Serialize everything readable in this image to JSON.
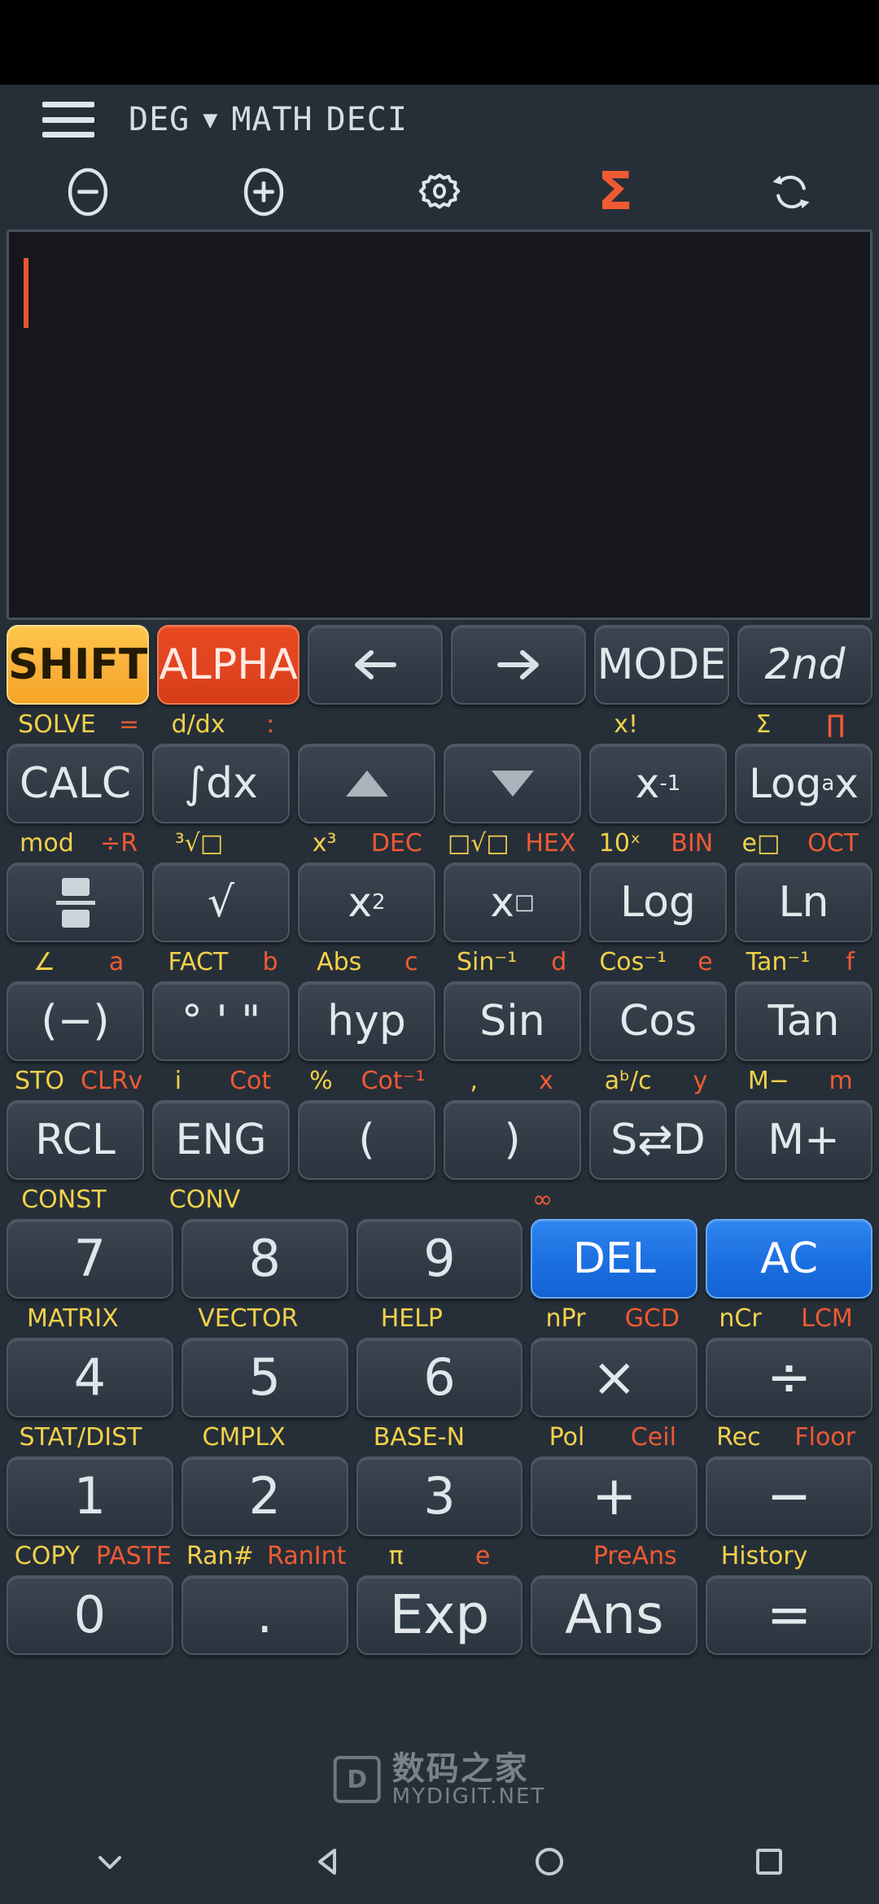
{
  "header": {
    "menu_icon": "hamburger-menu-icon",
    "angle_mode": "DEG",
    "caret": "▼",
    "math_mode": "MATH",
    "base_mode": "DECI"
  },
  "toolbar": [
    {
      "name": "zoom-out-button",
      "icon": "minus-circle-icon"
    },
    {
      "name": "zoom-in-button",
      "icon": "plus-circle-icon"
    },
    {
      "name": "settings-button",
      "icon": "gear-icon"
    },
    {
      "name": "sigma-button",
      "icon": "sigma-icon",
      "glyph": "Σ",
      "color": "#f05a32"
    },
    {
      "name": "refresh-button",
      "icon": "refresh-icon"
    }
  ],
  "display": {
    "value": "",
    "cursor_visible": true,
    "background": "#15171c",
    "cursor_color": "#e8552e"
  },
  "colors": {
    "shift_label": "#f2d14a",
    "alpha_label": "#ef5a33",
    "shift_key": "#fbb03b",
    "alpha_key": "#e0431f",
    "blue_key": "#1b6fe0",
    "keypad_bg": "#262f38",
    "key_face": "#36404b"
  },
  "keypad": {
    "rows": [
      {
        "labels": [],
        "keys": [
          {
            "name": "shift-key",
            "label": "SHIFT",
            "style": "shift"
          },
          {
            "name": "alpha-key",
            "label": "ALPHA",
            "style": "alpha"
          },
          {
            "name": "left-key",
            "label": "←",
            "style": "arrow"
          },
          {
            "name": "right-key",
            "label": "→",
            "style": "arrow"
          },
          {
            "name": "mode-key",
            "label": "MODE",
            "style": "text"
          },
          {
            "name": "2nd-key",
            "label": "2nd",
            "style": "italic"
          }
        ]
      },
      {
        "labels": [
          {
            "shift": "SOLVE",
            "alpha": "="
          },
          {
            "shift": "d/dx",
            "alpha": ":"
          },
          {
            "shift": "",
            "alpha": ""
          },
          {
            "shift": "",
            "alpha": ""
          },
          {
            "shift": "x!",
            "alpha": ""
          },
          {
            "shift": "Σ",
            "alpha": "∏"
          }
        ],
        "keys": [
          {
            "name": "calc-key",
            "label": "CALC"
          },
          {
            "name": "integral-key",
            "label": "∫dx"
          },
          {
            "name": "up-key",
            "label": "▲",
            "style": "tri-up"
          },
          {
            "name": "down-key",
            "label": "▼",
            "style": "tri-dn"
          },
          {
            "name": "inverse-key",
            "label": "x⁻¹",
            "base": "x",
            "sup": "-1"
          },
          {
            "name": "log-base-key",
            "label": "Logₐx",
            "base": "Log",
            "sub": "a",
            "tail": "x"
          }
        ]
      },
      {
        "labels": [
          {
            "shift": "mod",
            "alpha": "÷R"
          },
          {
            "shift": "³√□",
            "alpha": ""
          },
          {
            "shift": "x³",
            "alpha": "DEC"
          },
          {
            "shift": "□√□",
            "alpha": "HEX"
          },
          {
            "shift": "10ˣ",
            "alpha": "BIN"
          },
          {
            "shift": "e□",
            "alpha": "OCT"
          }
        ],
        "keys": [
          {
            "name": "fraction-key",
            "label": "▤",
            "style": "frac"
          },
          {
            "name": "sqrt-key",
            "label": "√"
          },
          {
            "name": "square-key",
            "label": "x²",
            "base": "x",
            "sup": "2"
          },
          {
            "name": "power-key",
            "label": "x□",
            "base": "x",
            "sup": "□"
          },
          {
            "name": "log-key",
            "label": "Log"
          },
          {
            "name": "ln-key",
            "label": "Ln"
          }
        ]
      },
      {
        "labels": [
          {
            "shift": "∠",
            "alpha": "a"
          },
          {
            "shift": "FACT",
            "alpha": "b"
          },
          {
            "shift": "Abs",
            "alpha": "c"
          },
          {
            "shift": "Sin⁻¹",
            "alpha": "d"
          },
          {
            "shift": "Cos⁻¹",
            "alpha": "e"
          },
          {
            "shift": "Tan⁻¹",
            "alpha": "f"
          }
        ],
        "keys": [
          {
            "name": "negative-key",
            "label": "(−)"
          },
          {
            "name": "dms-key",
            "label": "° ' \""
          },
          {
            "name": "hyp-key",
            "label": "hyp"
          },
          {
            "name": "sin-key",
            "label": "Sin"
          },
          {
            "name": "cos-key",
            "label": "Cos"
          },
          {
            "name": "tan-key",
            "label": "Tan"
          }
        ]
      },
      {
        "labels": [
          {
            "shift": "STO",
            "alpha": "CLRv"
          },
          {
            "shift": "i",
            "alpha": "Cot"
          },
          {
            "shift": "%",
            "alpha": "Cot⁻¹"
          },
          {
            "shift": ",",
            "alpha": "x"
          },
          {
            "shift": "aᵇ/c",
            "alpha": "y"
          },
          {
            "shift": "M−",
            "alpha": "m"
          }
        ],
        "keys": [
          {
            "name": "rcl-key",
            "label": "RCL"
          },
          {
            "name": "eng-key",
            "label": "ENG"
          },
          {
            "name": "lparen-key",
            "label": "("
          },
          {
            "name": "rparen-key",
            "label": ")"
          },
          {
            "name": "s-to-d-key",
            "label": "S⇄D"
          },
          {
            "name": "memory-plus-key",
            "label": "M+"
          }
        ]
      },
      {
        "labels": [
          {
            "shift": "CONST",
            "alpha": ""
          },
          {
            "shift": "CONV",
            "alpha": ""
          },
          {
            "shift": "",
            "alpha": ""
          },
          {
            "shift": "",
            "alpha": "∞"
          },
          {
            "shift": "",
            "alpha": ""
          },
          {
            "shift": "",
            "alpha": ""
          }
        ],
        "keys": [
          {
            "name": "seven-key",
            "label": "7",
            "style": "num",
            "span": 2
          },
          {
            "name": "eight-key",
            "label": "8",
            "style": "num",
            "span": 2
          },
          {
            "name": "nine-key",
            "label": "9",
            "style": "num",
            "span": 2
          },
          {
            "name": "del-key",
            "label": "DEL",
            "style": "blue",
            "span": 2
          },
          {
            "name": "ac-key",
            "label": "AC",
            "style": "blue",
            "span": 2
          }
        ]
      },
      {
        "labels": [
          {
            "shift": "MATRIX",
            "alpha": ""
          },
          {
            "shift": "VECTOR",
            "alpha": ""
          },
          {
            "shift": "HELP",
            "alpha": ""
          },
          {
            "shift": "nPr",
            "alpha": "GCD"
          },
          {
            "shift": "nCr",
            "alpha": "LCM"
          }
        ],
        "keys": [
          {
            "name": "four-key",
            "label": "4",
            "style": "num"
          },
          {
            "name": "five-key",
            "label": "5",
            "style": "num"
          },
          {
            "name": "six-key",
            "label": "6",
            "style": "num"
          },
          {
            "name": "multiply-key",
            "label": "×",
            "style": "big"
          },
          {
            "name": "divide-key",
            "label": "÷",
            "style": "big"
          }
        ]
      },
      {
        "labels": [
          {
            "shift": "STAT/DIST",
            "alpha": ""
          },
          {
            "shift": "CMPLX",
            "alpha": ""
          },
          {
            "shift": "BASE-N",
            "alpha": ""
          },
          {
            "shift": "Pol",
            "alpha": "Ceil"
          },
          {
            "shift": "Rec",
            "alpha": "Floor"
          }
        ],
        "keys": [
          {
            "name": "one-key",
            "label": "1",
            "style": "num"
          },
          {
            "name": "two-key",
            "label": "2",
            "style": "num"
          },
          {
            "name": "three-key",
            "label": "3",
            "style": "num"
          },
          {
            "name": "plus-key",
            "label": "+",
            "style": "big"
          },
          {
            "name": "minus-key",
            "label": "−",
            "style": "big"
          }
        ]
      },
      {
        "labels": [
          {
            "shift": "COPY",
            "alpha": "PASTE"
          },
          {
            "shift": "Ran#",
            "alpha": "RanInt"
          },
          {
            "shift": "π",
            "alpha": "e"
          },
          {
            "shift": "",
            "alpha": "PreAns"
          },
          {
            "shift": "History",
            "alpha": ""
          }
        ],
        "keys": [
          {
            "name": "zero-key",
            "label": "0",
            "style": "num"
          },
          {
            "name": "decimal-key",
            "label": ".",
            "style": "num"
          },
          {
            "name": "exp-key",
            "label": "Exp",
            "style": "big"
          },
          {
            "name": "ans-key",
            "label": "Ans",
            "style": "big"
          },
          {
            "name": "equals-key",
            "label": "=",
            "style": "big"
          }
        ]
      }
    ]
  },
  "watermark": {
    "cn": "数码之家",
    "en": "MYDIGIT.NET",
    "badge": "D"
  },
  "navbar": [
    {
      "name": "nav-collapse-button",
      "icon": "chevron-down-icon"
    },
    {
      "name": "nav-back-button",
      "icon": "triangle-back-icon"
    },
    {
      "name": "nav-home-button",
      "icon": "circle-home-icon"
    },
    {
      "name": "nav-recents-button",
      "icon": "square-recents-icon"
    }
  ]
}
